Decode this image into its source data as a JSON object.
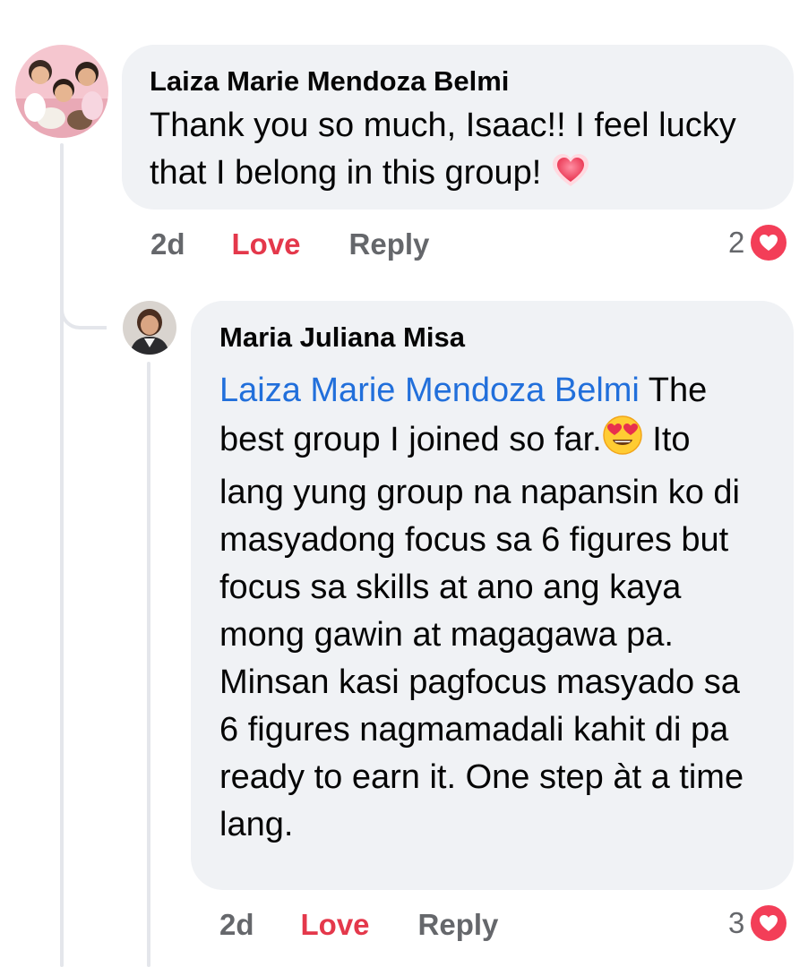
{
  "comments": [
    {
      "author": "Laiza Marie Mendoza Belmi",
      "text": "Thank you so much, Isaac!! I feel lucky that I belong in this group!",
      "emoji": "heart-emoji",
      "time": "2d",
      "love_label": "Love",
      "reply_label": "Reply",
      "reaction_count": "2",
      "reaction_icon": "love-reaction-icon"
    },
    {
      "author": "Maria Juliana Misa",
      "mention": "Laiza Marie Mendoza Belmi",
      "text_part1": " The best group I joined so far.",
      "emoji": "heart-eyes-emoji",
      "text_part2": " Ito lang yung group na napansin ko di masyadong focus sa 6 figures but focus sa  skills at ano ang kaya mong gawin at magagawa pa. Minsan kasi pagfocus masyado sa 6 figures nagmamadali kahit di pa ready to earn it. One step àt a time lang.",
      "time": "2d",
      "love_label": "Love",
      "reply_label": "Reply",
      "reaction_count": "3",
      "reaction_icon": "love-reaction-icon"
    }
  ],
  "colors": {
    "bubble": "#f0f2f5",
    "mention": "#216fdb",
    "love": "#e4384b",
    "meta": "#65676b",
    "heart_badge": "#f33e58"
  }
}
